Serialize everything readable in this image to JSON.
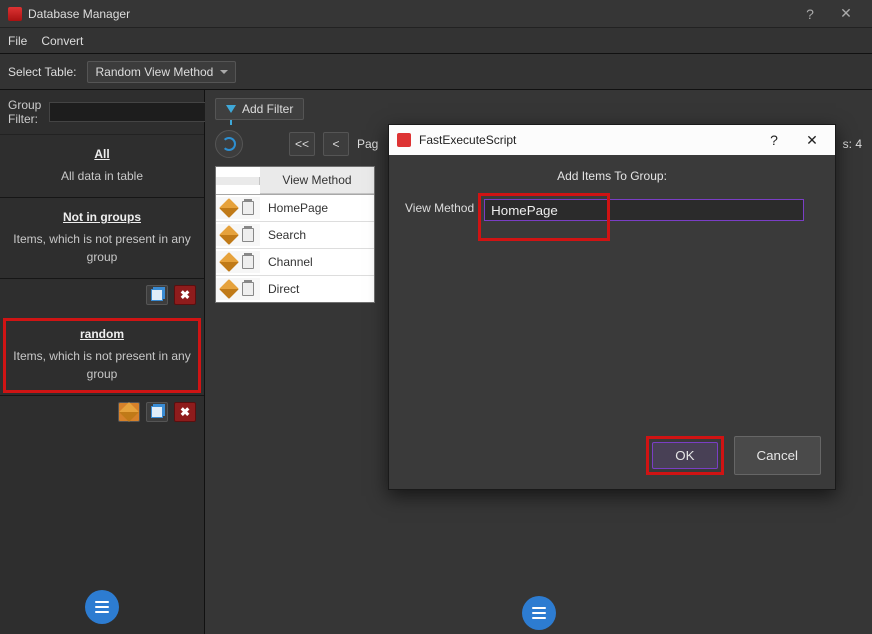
{
  "window": {
    "title": "Database Manager",
    "help": "?",
    "close": "✕"
  },
  "menu": {
    "file": "File",
    "convert": "Convert"
  },
  "select": {
    "label": "Select Table:",
    "value": "Random View Method"
  },
  "sidebar": {
    "filter_label": "Group Filter:",
    "filter_value": "",
    "groups": {
      "all": {
        "title": "All",
        "desc": "All data in table"
      },
      "not": {
        "title": "Not in groups",
        "desc": "Items, which is not present in any group"
      },
      "random": {
        "title": "random",
        "desc": "Items, which is not present in any group"
      }
    },
    "del_glyph": "✖"
  },
  "toolbar": {
    "add_filter": "Add Filter"
  },
  "pager": {
    "first": "<<",
    "prev": "<",
    "page_label": "Pag",
    "items_label": "s: 4"
  },
  "table": {
    "header": "View Method",
    "rows": [
      "HomePage",
      "Search",
      "Channel",
      "Direct"
    ]
  },
  "dialog": {
    "title": "FastExecuteScript",
    "help": "?",
    "close": "✕",
    "heading": "Add Items To Group:",
    "field_label": "View Method",
    "field_value": "HomePage",
    "ok": "OK",
    "cancel": "Cancel"
  }
}
